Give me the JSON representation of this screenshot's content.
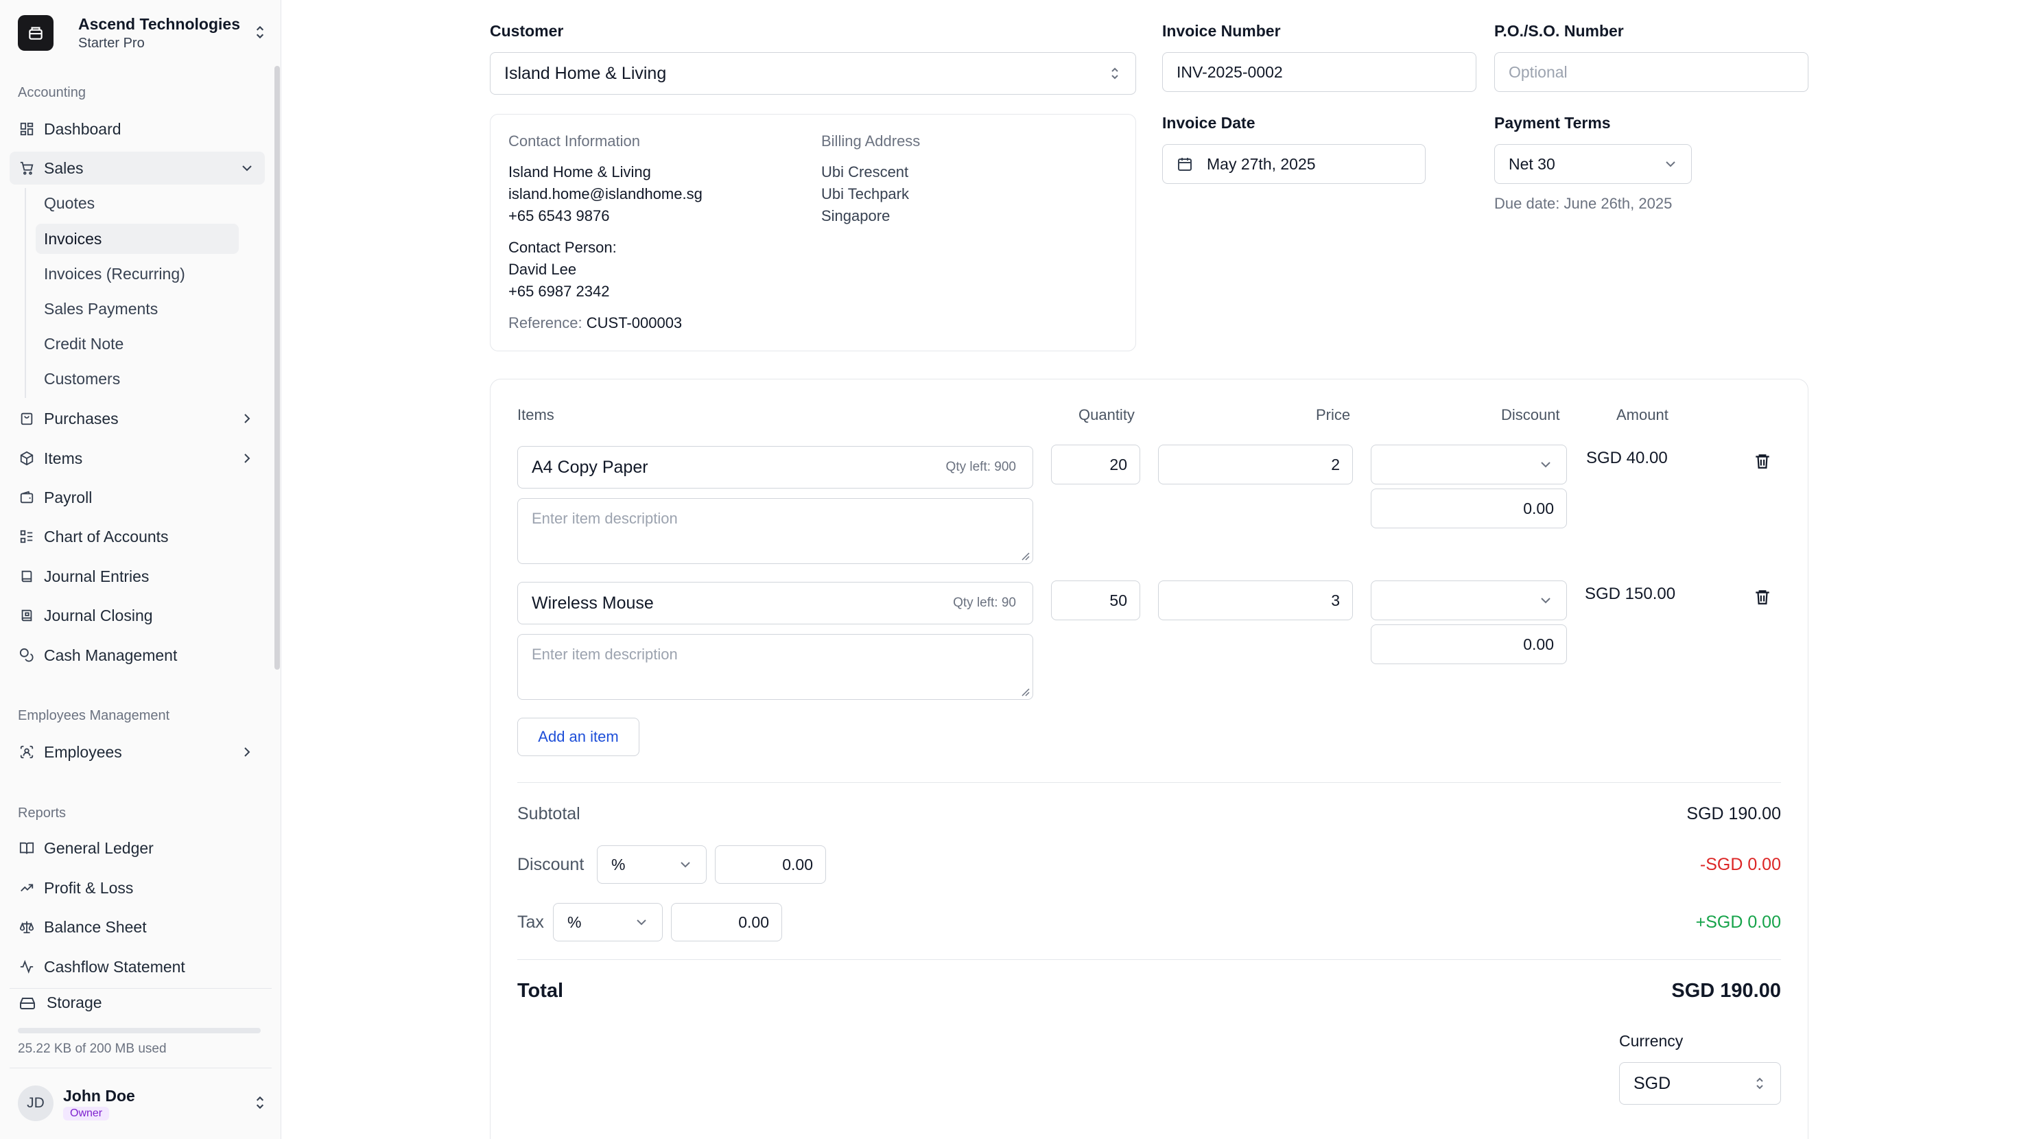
{
  "org": {
    "name": "Ascend Technologies",
    "plan": "Starter Pro"
  },
  "sidebar": {
    "section_accounting": "Accounting",
    "dashboard": "Dashboard",
    "sales": "Sales",
    "sales_sub": [
      "Quotes",
      "Invoices",
      "Invoices (Recurring)",
      "Sales Payments",
      "Credit Note",
      "Customers"
    ],
    "purchases": "Purchases",
    "items": "Items",
    "payroll": "Payroll",
    "chart_of_accounts": "Chart of Accounts",
    "journal_entries": "Journal Entries",
    "journal_closing": "Journal Closing",
    "cash_management": "Cash Management",
    "section_employees": "Employees Management",
    "employees": "Employees",
    "section_reports": "Reports",
    "general_ledger": "General Ledger",
    "profit_loss": "Profit & Loss",
    "balance_sheet": "Balance Sheet",
    "cashflow": "Cashflow Statement",
    "storage_label": "Storage",
    "storage_used": "25.22 KB of 200 MB used",
    "storage_fraction": 0.0001
  },
  "user": {
    "initials": "JD",
    "name": "John Doe",
    "role": "Owner"
  },
  "form": {
    "customer_label": "Customer",
    "customer_value": "Island Home & Living",
    "invoice_number_label": "Invoice Number",
    "invoice_number_value": "INV-2025-0002",
    "po_label": "P.O./S.O. Number",
    "po_placeholder": "Optional",
    "invoice_date_label": "Invoice Date",
    "invoice_date_value": "May 27th, 2025",
    "payment_terms_label": "Payment Terms",
    "payment_terms_value": "Net 30",
    "due_date": "Due date: June 26th, 2025"
  },
  "contact": {
    "info_head": "Contact Information",
    "name": "Island Home & Living",
    "email": "island.home@islandhome.sg",
    "phone": "+65 6543 9876",
    "person_label": "Contact Person:",
    "person_name": "David Lee",
    "person_phone": "+65 6987 2342",
    "reference_label": "Reference:",
    "reference_value": "CUST-000003",
    "billing_head": "Billing Address",
    "billing_lines": [
      "Ubi Crescent",
      "Ubi Techpark",
      "Singapore"
    ]
  },
  "items_table": {
    "headers": {
      "items": "Items",
      "quantity": "Quantity",
      "price": "Price",
      "discount": "Discount",
      "amount": "Amount"
    },
    "desc_placeholder": "Enter item description",
    "rows": [
      {
        "name": "A4 Copy Paper",
        "qty_left": "Qty left: 900",
        "quantity": "20",
        "price": "2",
        "discount_value": "0.00",
        "amount": "SGD 40.00"
      },
      {
        "name": "Wireless Mouse",
        "qty_left": "Qty left: 90",
        "quantity": "50",
        "price": "3",
        "discount_value": "0.00",
        "amount": "SGD 150.00"
      }
    ],
    "add_item": "Add an item"
  },
  "summary": {
    "subtotal_label": "Subtotal",
    "subtotal_value": "SGD 190.00",
    "discount_label": "Discount",
    "discount_type": "%",
    "discount_input": "0.00",
    "discount_value": "-SGD 0.00",
    "tax_label": "Tax",
    "tax_type": "%",
    "tax_input": "0.00",
    "tax_value": "+SGD 0.00",
    "total_label": "Total",
    "total_value": "SGD 190.00",
    "currency_label": "Currency",
    "currency_value": "SGD"
  },
  "colors": {
    "negative": "#dc2626",
    "positive": "#16a34a",
    "link": "#1d4ed8"
  }
}
